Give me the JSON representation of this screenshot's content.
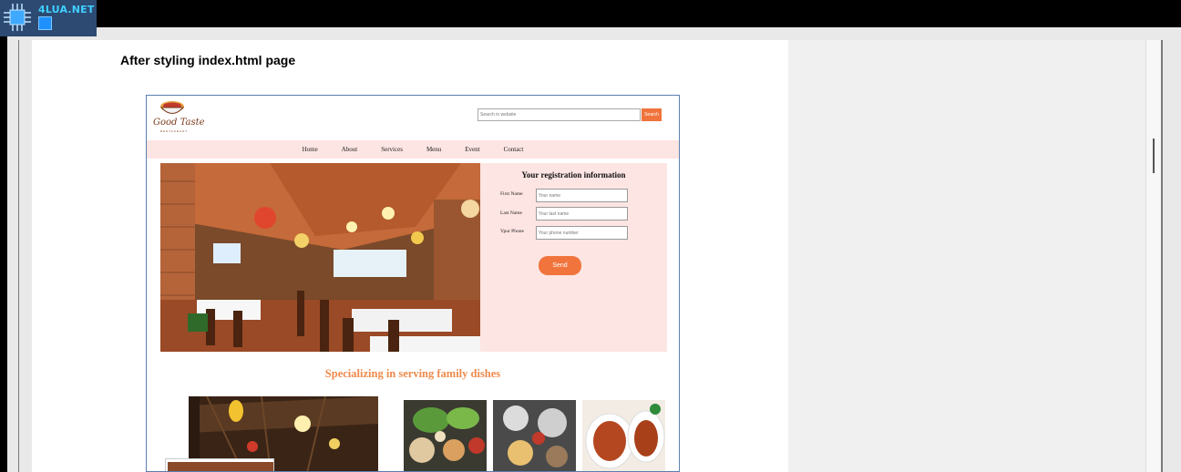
{
  "watermark": {
    "text": "4LUA.NET"
  },
  "document": {
    "heading": "After styling index.html page"
  },
  "site": {
    "brand": {
      "name": "Good Taste",
      "subtitle": "RESTAURANT"
    },
    "search": {
      "placeholder": "Search in website",
      "button": "Search"
    },
    "nav": [
      "Home",
      "About",
      "Services",
      "Menu",
      "Event",
      "Contact"
    ],
    "registration": {
      "title": "Your registration information",
      "fields": [
        {
          "label": "First Name",
          "placeholder": "Your name"
        },
        {
          "label": "Last Name",
          "placeholder": "Your last name"
        },
        {
          "label": "Ypur Phone",
          "placeholder": "Your phone number"
        }
      ],
      "send_label": "Send"
    },
    "tagline": "Specializing in serving family dishes"
  },
  "colors": {
    "accent": "#f0743c",
    "panel": "#fde5e3",
    "tagline": "#ee8a4b"
  }
}
